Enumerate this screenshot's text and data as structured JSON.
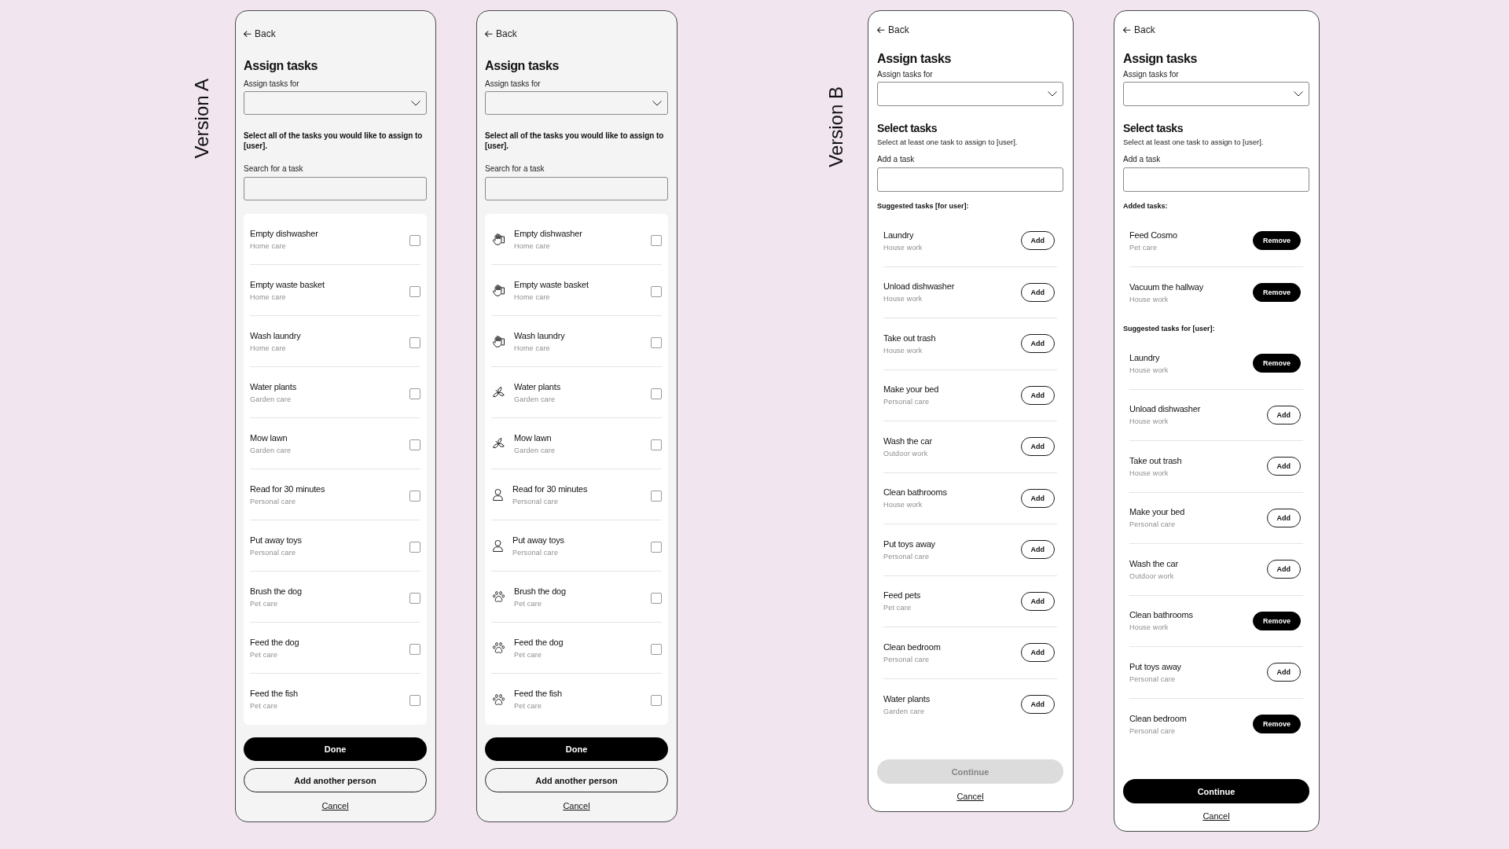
{
  "version_a": {
    "label": "Version A",
    "screens": [
      {
        "back": "Back",
        "title": "Assign tasks",
        "assignee_label": "Assign tasks for",
        "instruction": "Select all of the tasks you would like to assign to [user].",
        "search_label": "Search for a task",
        "tasks": [
          {
            "title": "Empty dishwasher",
            "category": "Home care",
            "checked": false
          },
          {
            "title": "Empty waste basket",
            "category": "Home care",
            "checked": false
          },
          {
            "title": "Wash laundry",
            "category": "Home care",
            "checked": false
          },
          {
            "title": "Water plants",
            "category": "Garden care",
            "checked": false
          },
          {
            "title": "Mow lawn",
            "category": "Garden care",
            "checked": false
          },
          {
            "title": "Read for 30 minutes",
            "category": "Personal care",
            "checked": false
          },
          {
            "title": "Put away toys",
            "category": "Personal care",
            "checked": false
          },
          {
            "title": "Brush the dog",
            "category": "Pet care",
            "checked": false
          },
          {
            "title": "Feed the dog",
            "category": "Pet care",
            "checked": false
          },
          {
            "title": "Feed the fish",
            "category": "Pet care",
            "checked": false
          }
        ],
        "primary_button": "Done",
        "secondary_button": "Add another person",
        "cancel": "Cancel"
      },
      {
        "back": "Back",
        "title": "Assign tasks",
        "assignee_label": "Assign tasks for",
        "instruction": "Select all of the tasks you would like to assign to [user].",
        "search_label": "Search for a task",
        "tasks": [
          {
            "title": "Empty dishwasher",
            "category": "Home care",
            "kind": "home",
            "checked": false
          },
          {
            "title": "Empty waste basket",
            "category": "Home care",
            "kind": "home",
            "checked": false
          },
          {
            "title": "Wash laundry",
            "category": "Home care",
            "kind": "home",
            "checked": false
          },
          {
            "title": "Water plants",
            "category": "Garden care",
            "kind": "garden",
            "checked": false
          },
          {
            "title": "Mow lawn",
            "category": "Garden care",
            "kind": "garden",
            "checked": false
          },
          {
            "title": "Read for 30 minutes",
            "category": "Personal care",
            "kind": "personal",
            "checked": false
          },
          {
            "title": "Put away toys",
            "category": "Personal care",
            "kind": "personal",
            "checked": false
          },
          {
            "title": "Brush the dog",
            "category": "Pet care",
            "kind": "pet",
            "checked": false
          },
          {
            "title": "Feed the dog",
            "category": "Pet care",
            "kind": "pet",
            "checked": false
          },
          {
            "title": "Feed the fish",
            "category": "Pet care",
            "kind": "pet",
            "checked": false
          }
        ],
        "primary_button": "Done",
        "secondary_button": "Add another person",
        "cancel": "Cancel"
      }
    ]
  },
  "version_b": {
    "label": "Version B",
    "screens": [
      {
        "back": "Back",
        "title": "Assign tasks",
        "assignee_label": "Assign tasks for",
        "section_title": "Select tasks",
        "section_hint": "Select at least one task to assign to [user].",
        "add_label": "Add a task",
        "groups": [
          {
            "heading": "Suggested tasks [for user]:",
            "tasks": [
              {
                "title": "Laundry",
                "category": "House work",
                "action": "Add",
                "added": false
              },
              {
                "title": "Unload dishwasher",
                "category": "House work",
                "action": "Add",
                "added": false
              },
              {
                "title": "Take out trash",
                "category": "House work",
                "action": "Add",
                "added": false
              },
              {
                "title": "Make your bed",
                "category": "Personal care",
                "action": "Add",
                "added": false
              },
              {
                "title": "Wash the car",
                "category": "Outdoor work",
                "action": "Add",
                "added": false
              },
              {
                "title": "Clean bathrooms",
                "category": "House work",
                "action": "Add",
                "added": false
              },
              {
                "title": "Put toys away",
                "category": "Personal care",
                "action": "Add",
                "added": false
              },
              {
                "title": "Feed pets",
                "category": "Pet care",
                "action": "Add",
                "added": false
              },
              {
                "title": "Clean bedroom",
                "category": "Personal care",
                "action": "Add",
                "added": false
              },
              {
                "title": "Water plants",
                "category": "Garden care",
                "action": "Add",
                "added": false
              }
            ]
          }
        ],
        "continue_button": {
          "label": "Continue",
          "disabled": true
        },
        "cancel": "Cancel"
      },
      {
        "back": "Back",
        "title": "Assign tasks",
        "assignee_label": "Assign tasks for",
        "section_title": "Select tasks",
        "section_hint": "Select at least one task to assign to [user].",
        "add_label": "Add a task",
        "groups": [
          {
            "heading": "Added tasks:",
            "tasks": [
              {
                "title": "Feed Cosmo",
                "category": "Pet care",
                "action": "Remove",
                "added": true
              },
              {
                "title": "Vacuum the hallway",
                "category": "House work",
                "action": "Remove",
                "added": true
              }
            ]
          },
          {
            "heading": "Suggested tasks for [user]:",
            "tasks": [
              {
                "title": "Laundry",
                "category": "House work",
                "action": "Remove",
                "added": true
              },
              {
                "title": "Unload dishwasher",
                "category": "House work",
                "action": "Add",
                "added": false
              },
              {
                "title": "Take out trash",
                "category": "House work",
                "action": "Add",
                "added": false
              },
              {
                "title": "Make your bed",
                "category": "Personal care",
                "action": "Add",
                "added": false
              },
              {
                "title": "Wash the car",
                "category": "Outdoor work",
                "action": "Add",
                "added": false
              },
              {
                "title": "Clean bathrooms",
                "category": "House work",
                "action": "Remove",
                "added": true
              },
              {
                "title": "Put toys away",
                "category": "Personal care",
                "action": "Add",
                "added": false
              },
              {
                "title": "Clean bedroom",
                "category": "Personal care",
                "action": "Remove",
                "added": true
              }
            ]
          }
        ],
        "continue_button": {
          "label": "Continue",
          "disabled": false
        },
        "cancel": "Cancel"
      }
    ]
  }
}
